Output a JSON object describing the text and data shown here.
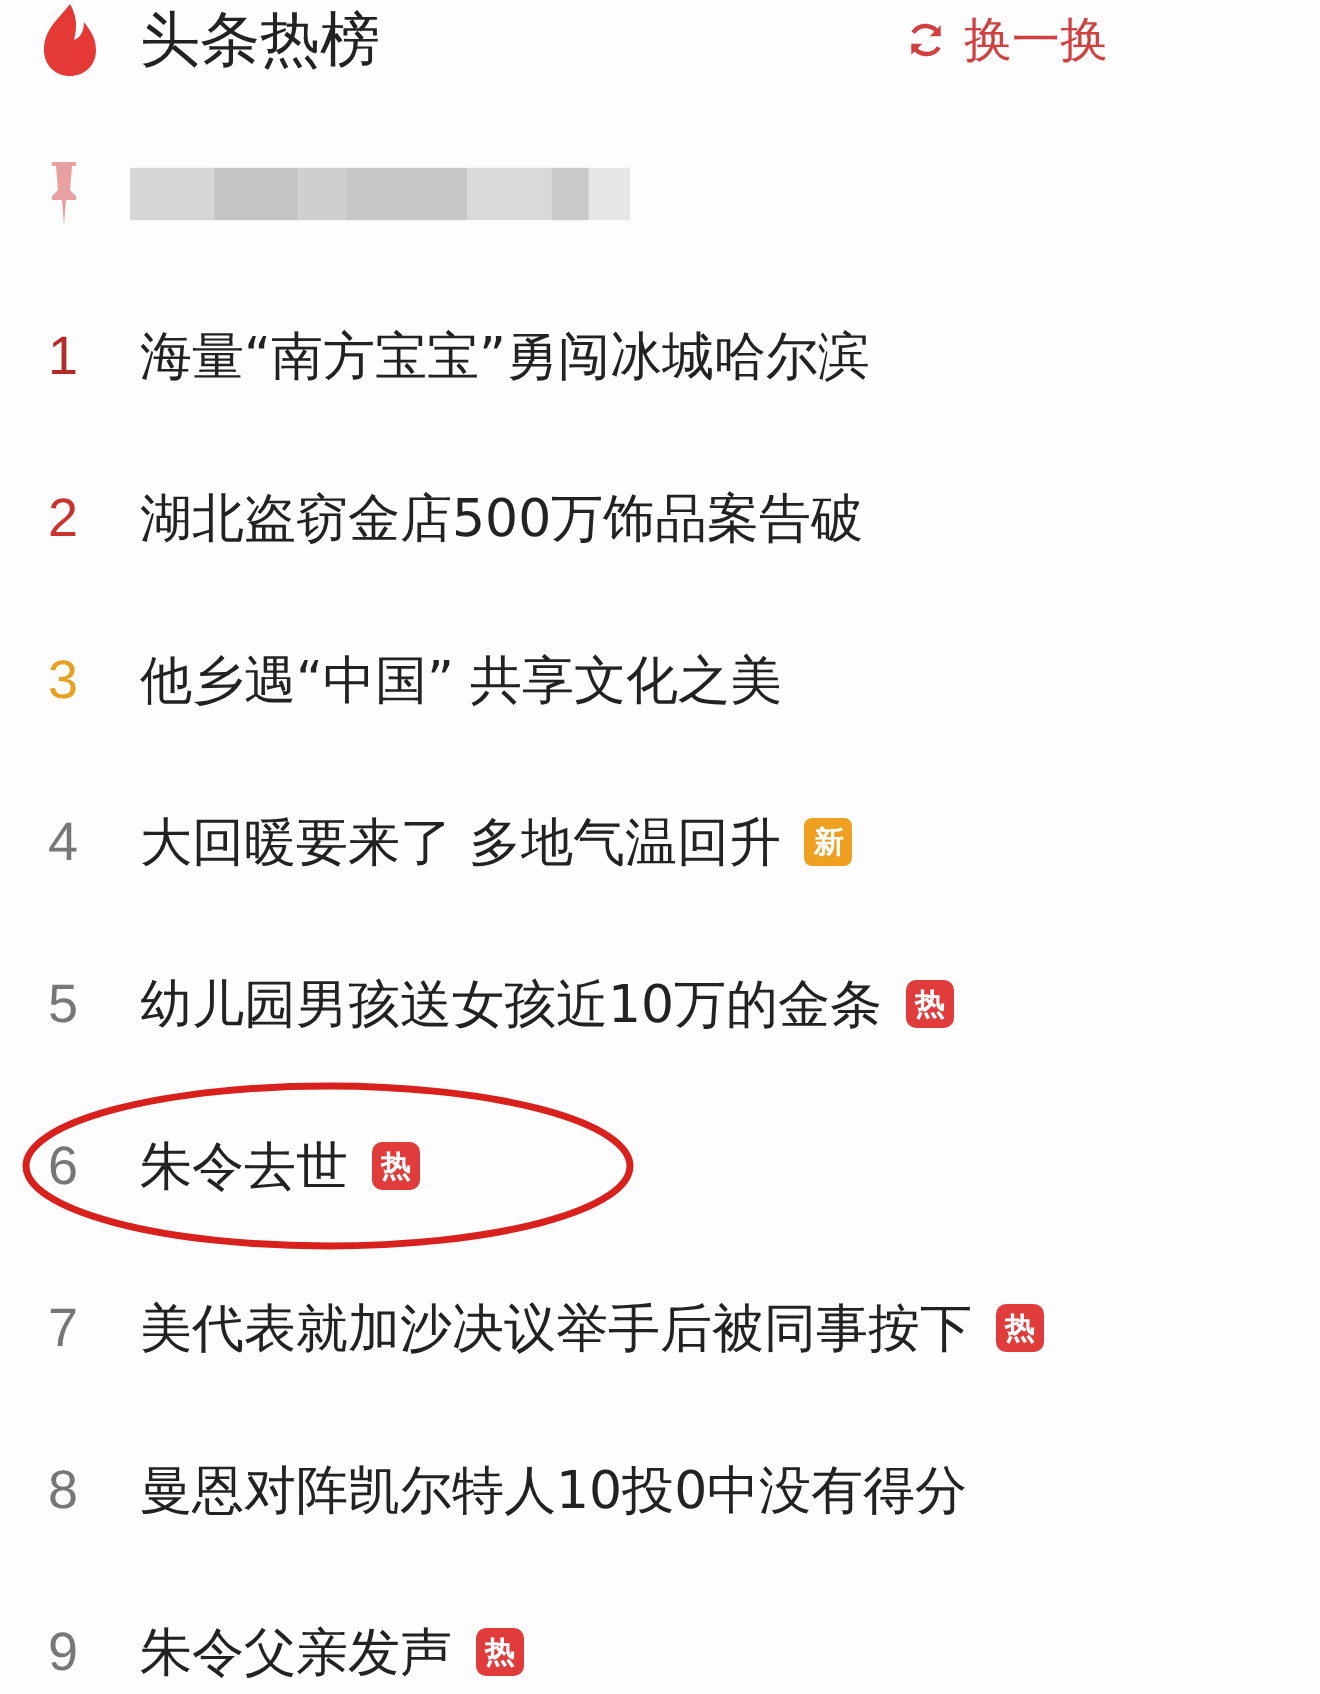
{
  "header": {
    "title": "头条热榜",
    "refresh": "换一换"
  },
  "pinned": {
    "blurred": true
  },
  "items": [
    {
      "rank": "1",
      "color": "#b22a2a",
      "text": "海量“南方宝宝”勇闯冰城哈尔滨",
      "circled": false
    },
    {
      "rank": "2",
      "color": "#c8332c",
      "text": "湖北盗窃金店500万饰品案告破",
      "circled": false
    },
    {
      "rank": "3",
      "color": "#e8a020",
      "text": "他乡遇“中国” 共享文化之美",
      "circled": false
    },
    {
      "rank": "4",
      "color": "#777777",
      "text": "大回暖要来了 多地气温回升",
      "badge": {
        "kind": "new",
        "text": "新",
        "color": "#f0a020"
      },
      "circled": false
    },
    {
      "rank": "5",
      "color": "#777777",
      "text": "幼儿园男孩送女孩近10万的金条",
      "badge": {
        "kind": "hot",
        "text": "热",
        "color": "#e03c3c"
      },
      "circled": false
    },
    {
      "rank": "6",
      "color": "#777777",
      "text": "朱令去世",
      "badge": {
        "kind": "hot",
        "text": "热",
        "color": "#e03c3c"
      },
      "circled": true
    },
    {
      "rank": "7",
      "color": "#777777",
      "text": "美代表就加沙决议举手后被同事按下",
      "badge": {
        "kind": "hot",
        "text": "热",
        "color": "#e03c3c"
      },
      "circled": false
    },
    {
      "rank": "8",
      "color": "#777777",
      "text": "曼恩对阵凯尔特人10投0中没有得分",
      "circled": false
    },
    {
      "rank": "9",
      "color": "#777777",
      "text": "朱令父亲发声",
      "badge": {
        "kind": "hot",
        "text": "热",
        "color": "#e03c3c"
      },
      "circled": false
    }
  ]
}
